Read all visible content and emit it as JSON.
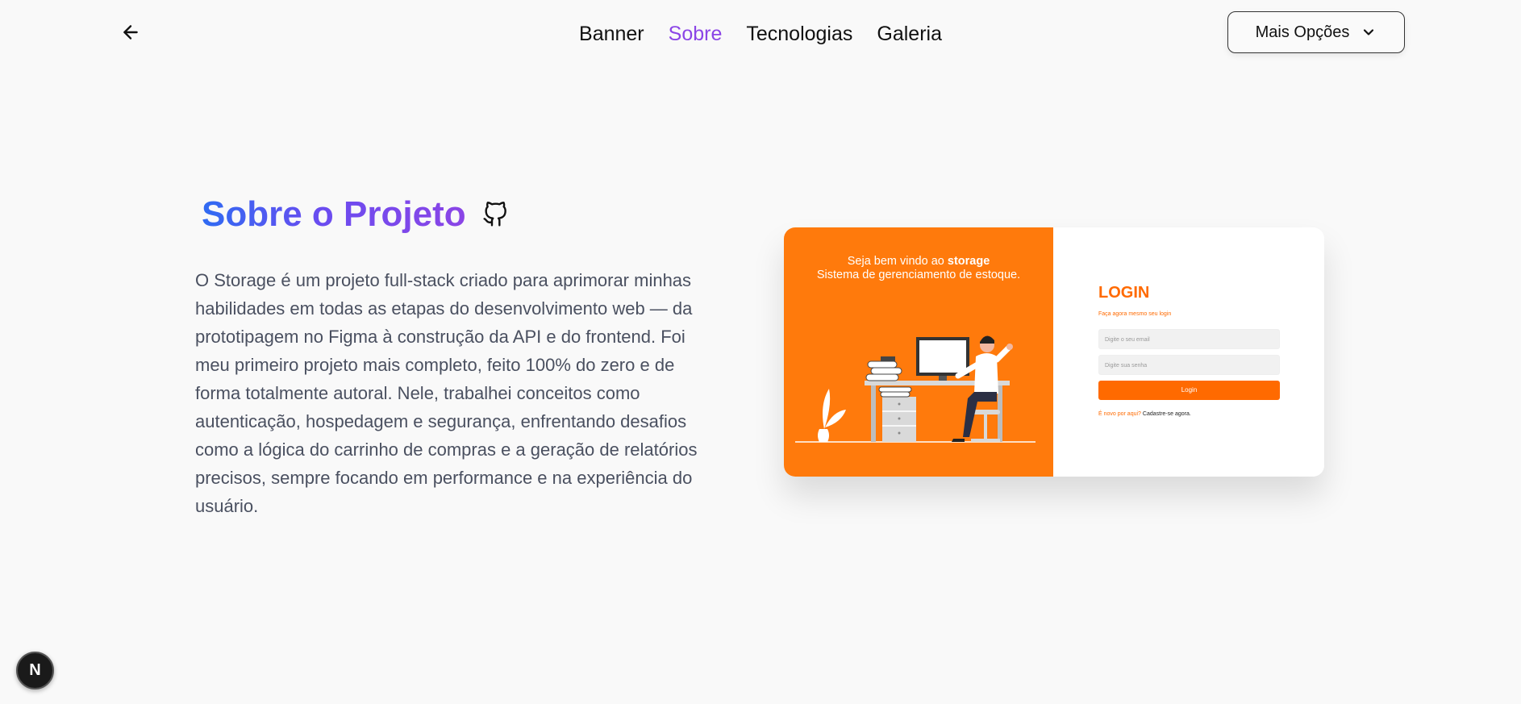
{
  "header": {
    "back_icon": "arrow-left-icon",
    "nav": [
      {
        "label": "Banner",
        "active": false
      },
      {
        "label": "Sobre",
        "active": true
      },
      {
        "label": "Tecnologias",
        "active": false
      },
      {
        "label": "Galeria",
        "active": false
      }
    ],
    "more_options": {
      "label": "Mais Opções",
      "icon": "chevron-down-icon"
    }
  },
  "about": {
    "title": "Sobre o Projeto",
    "github_icon": "github-icon",
    "description": "O Storage é um projeto full-stack criado para aprimorar minhas habilidades em todas as etapas do desenvolvimento web — da prototipagem no Figma à construção da API e do frontend. Foi meu primeiro projeto mais completo, feito 100% do zero e de forma totalmente autoral. Nele, trabalhei conceitos como autenticação, hospedagem e segurança, enfrentando desafios como a lógica do carrinho de compras e a geração de relatórios precisos, sempre focando em performance e na experiência do usuário."
  },
  "preview": {
    "welcome_prefix": "Seja bem vindo ao ",
    "welcome_brand": "storage",
    "welcome_line2": "Sistema de gerenciamento de estoque.",
    "login_title": "LOGIN",
    "login_subtitle": "Faça agora mesmo seu login",
    "email_placeholder": "Digite o seu email",
    "password_placeholder": "Digite sua senha",
    "login_button": "Login",
    "signup_prompt": "É novo por aqui?",
    "signup_link": "Cadastre-se agora.",
    "accent_color": "#ff7a0c"
  },
  "dev_badge": {
    "label": "N"
  },
  "colors": {
    "background": "#f9f9f9",
    "active_nav": "#8b45e6",
    "title_gradient_start": "#2f6bf2",
    "title_gradient_end": "#8b45e6"
  }
}
